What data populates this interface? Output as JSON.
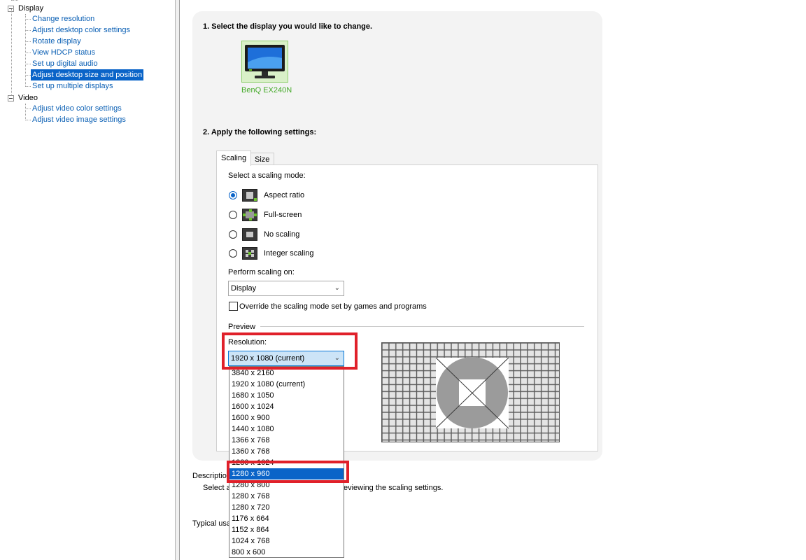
{
  "tree": {
    "categories": [
      {
        "label": "Display",
        "items": [
          {
            "label": "Change resolution"
          },
          {
            "label": "Adjust desktop color settings"
          },
          {
            "label": "Rotate display"
          },
          {
            "label": "View HDCP status"
          },
          {
            "label": "Set up digital audio"
          },
          {
            "label": "Adjust desktop size and position",
            "selected": true
          },
          {
            "label": "Set up multiple displays"
          }
        ]
      },
      {
        "label": "Video",
        "items": [
          {
            "label": "Adjust video color settings"
          },
          {
            "label": "Adjust video image settings"
          }
        ]
      }
    ]
  },
  "main": {
    "step1_heading": "1. Select the display you would like to change.",
    "monitor_name": "BenQ EX240N",
    "step2_heading": "2. Apply the following settings:",
    "tabs": [
      {
        "label": "Scaling",
        "active": true
      },
      {
        "label": "Size",
        "active": false
      }
    ],
    "scaling_mode_label": "Select a scaling mode:",
    "scaling_modes": [
      {
        "label": "Aspect ratio",
        "checked": true
      },
      {
        "label": "Full-screen",
        "checked": false
      },
      {
        "label": "No scaling",
        "checked": false
      },
      {
        "label": "Integer scaling",
        "checked": false
      }
    ],
    "perform_on_label": "Perform scaling on:",
    "perform_on_value": "Display",
    "override_label": "Override the scaling mode set by games and programs",
    "override_checked": false,
    "preview_label": "Preview",
    "resolution_label": "Resolution:",
    "resolution_value": "1920 x 1080 (current)",
    "resolution_options": [
      "3840 x 2160",
      "1920 x 1080 (current)",
      "1680 x 1050",
      "1600 x 1024",
      "1600 x 900",
      "1440 x 1080",
      "1366 x 768",
      "1360 x 768",
      "1280 x 1024",
      "1280 x 960",
      "1280 x 800",
      "1280 x 768",
      "1280 x 720",
      "1176 x 664",
      "1152 x 864",
      "1024 x 768",
      "800 x 600"
    ],
    "selected_option": "1280 x 960",
    "description_label": "Descriptio",
    "description_text_left": "Select a",
    "description_text_right": "eviewing the scaling settings.",
    "typical_label": "Typical usa"
  },
  "colors": {
    "accent": "#0a64c8",
    "link": "#0a5fb4",
    "highlight": "#e0202a",
    "nvidia_green": "#43a927"
  }
}
